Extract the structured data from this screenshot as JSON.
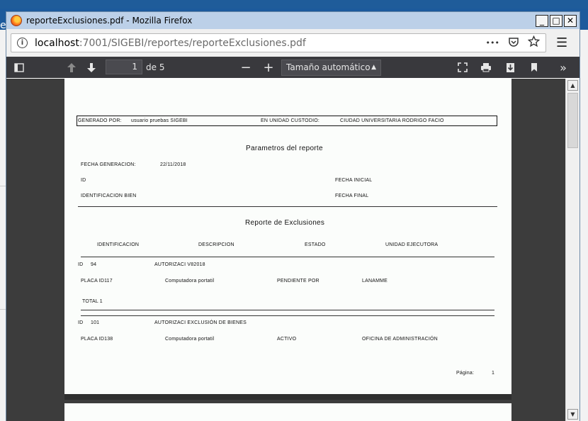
{
  "window": {
    "title": "reporteExclusiones.pdf - Mozilla Firefox",
    "minimize": "_",
    "maximize": "□",
    "close": "✕"
  },
  "background": {
    "letter": "e"
  },
  "urlbar": {
    "host": "localhost",
    "path": ":7001/SIGEBI/reportes/reporteExclusiones.pdf",
    "more": "•••"
  },
  "pdf_toolbar": {
    "page": "1",
    "of_pages": "de 5",
    "zoom": "Tamaño automático"
  },
  "report": {
    "generado_por_label": "GENERADO POR:",
    "generado_por_value": "usuario pruebas SIGEBI",
    "unidad_custodio_label": "EN UNIDAD CUSTODIO:",
    "unidad_custodio_value": "CIUDAD UNIVERSITARIA RODRIGO FACIO",
    "params_title": "Parametros del reporte",
    "fecha_generacion_label": "FECHA GENERACION:",
    "fecha_generacion_value": "22/11/2018",
    "id_label": "ID",
    "fecha_inicial_label": "FECHA INICIAL",
    "identificacion_bien_label": "IDENTIFICACION BIEN",
    "fecha_final_label": "FECHA FINAL",
    "report_title": "Reporte de Exclusiones",
    "columns": [
      "IDENTIFICACION",
      "DESCRIPCION",
      "ESTADO",
      "UNIDAD EJECUTORA"
    ],
    "groups": [
      {
        "id_label": "ID",
        "id_value": "94",
        "autorizacion": "AUTORIZACI V82018",
        "placa": "PLACA ID117",
        "descripcion": "Computadora portatil",
        "estado": "PENDIENTE POR",
        "unidad": "LANAMME",
        "total": "TOTAL 1"
      },
      {
        "id_label": "ID",
        "id_value": "101",
        "autorizacion": "AUTORIZACI EXCLUSIÓN DE BIENES",
        "placa": "PLACA ID138",
        "descripcion": "Computadora portatil",
        "estado": "ACTIVO",
        "unidad": "OFICINA DE ADMINISTRACIÓN"
      }
    ],
    "page_label": "Página:",
    "page_value": "1"
  }
}
